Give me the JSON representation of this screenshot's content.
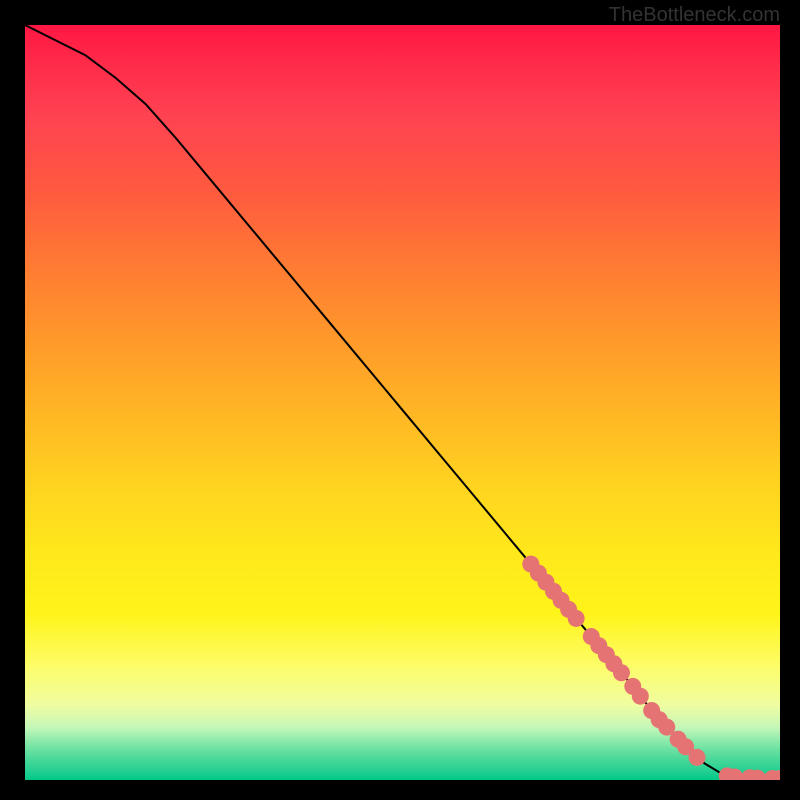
{
  "watermark": "TheBottleneck.com",
  "chart_data": {
    "type": "line",
    "title": "",
    "xlabel": "",
    "ylabel": "",
    "xlim": [
      0,
      100
    ],
    "ylim": [
      0,
      100
    ],
    "series": [
      {
        "name": "curve",
        "x": [
          0,
          4,
          8,
          12,
          16,
          20,
          25,
          30,
          35,
          40,
          45,
          50,
          55,
          60,
          65,
          70,
          75,
          80,
          84,
          88,
          90,
          92,
          94,
          96,
          98,
          100
        ],
        "y": [
          100,
          98,
          96,
          93,
          89.5,
          85,
          79,
          73,
          67,
          61,
          55,
          49,
          43,
          37,
          31,
          25,
          19,
          13,
          8,
          4,
          2.2,
          1.0,
          0.4,
          0.3,
          0.2,
          0.2
        ]
      }
    ],
    "markers": [
      {
        "x": 67,
        "y": 28.6
      },
      {
        "x": 68,
        "y": 27.4
      },
      {
        "x": 69,
        "y": 26.2
      },
      {
        "x": 70,
        "y": 25.0
      },
      {
        "x": 71,
        "y": 23.8
      },
      {
        "x": 72,
        "y": 22.6
      },
      {
        "x": 73,
        "y": 21.4
      },
      {
        "x": 75,
        "y": 19.0
      },
      {
        "x": 76,
        "y": 17.8
      },
      {
        "x": 77,
        "y": 16.6
      },
      {
        "x": 78,
        "y": 15.4
      },
      {
        "x": 79,
        "y": 14.2
      },
      {
        "x": 80.5,
        "y": 12.4
      },
      {
        "x": 81.5,
        "y": 11.1
      },
      {
        "x": 83,
        "y": 9.2
      },
      {
        "x": 84,
        "y": 8.0
      },
      {
        "x": 85,
        "y": 7.0
      },
      {
        "x": 86.5,
        "y": 5.4
      },
      {
        "x": 87.5,
        "y": 4.4
      },
      {
        "x": 89,
        "y": 3.0
      },
      {
        "x": 93,
        "y": 0.55
      },
      {
        "x": 94,
        "y": 0.4
      },
      {
        "x": 96,
        "y": 0.3
      },
      {
        "x": 97,
        "y": 0.25
      },
      {
        "x": 99,
        "y": 0.2
      },
      {
        "x": 100,
        "y": 0.2
      }
    ],
    "marker_color": "#e57373",
    "curve_color": "#000000"
  }
}
